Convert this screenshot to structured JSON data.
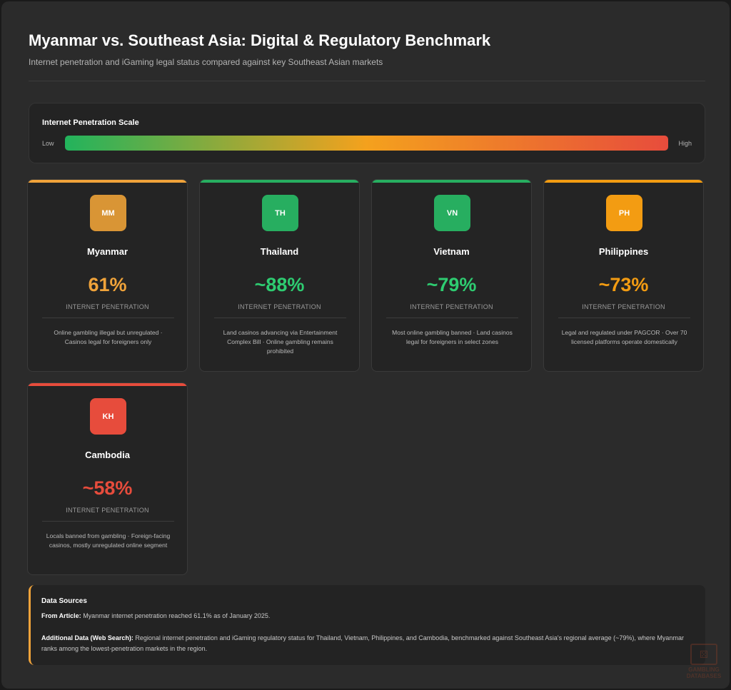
{
  "header": {
    "title": "Myanmar vs. Southeast Asia: Digital & Regulatory Benchmark",
    "subtitle": "Internet penetration and iGaming legal status compared against key Southeast Asian markets"
  },
  "scale": {
    "title": "Internet Penetration Scale",
    "low_label": "Low",
    "high_label": "High",
    "gradient_colors": [
      "#22b35c",
      "#f4a11d",
      "#e74c3c"
    ]
  },
  "cards": [
    {
      "code": "MM",
      "name": "Myanmar",
      "penetration": "61%",
      "label": "INTERNET PENETRATION",
      "description": "Online gambling illegal but unregulated · Casinos legal for foreigners only",
      "accent": "#f0a33a",
      "badge_color": "#d99535",
      "value_color": "#f0a33a"
    },
    {
      "code": "TH",
      "name": "Thailand",
      "penetration": "~88%",
      "label": "INTERNET PENETRATION",
      "description": "Land casinos advancing via Entertainment Complex Bill · Online gambling remains prohibited",
      "accent": "#27ae60",
      "badge_color": "#27ae60",
      "value_color": "#2ecc71"
    },
    {
      "code": "VN",
      "name": "Vietnam",
      "penetration": "~79%",
      "label": "INTERNET PENETRATION",
      "description": "Most online gambling banned · Land casinos legal for foreigners in select zones",
      "accent": "#27ae60",
      "badge_color": "#27ae60",
      "value_color": "#2ecc71"
    },
    {
      "code": "PH",
      "name": "Philippines",
      "penetration": "~73%",
      "label": "INTERNET PENETRATION",
      "description": "Legal and regulated under PAGCOR · Over 70 licensed platforms operate domestically",
      "accent": "#f39c12",
      "badge_color": "#f39c12",
      "value_color": "#f39c12"
    },
    {
      "code": "KH",
      "name": "Cambodia",
      "penetration": "~58%",
      "label": "INTERNET PENETRATION",
      "description": "Locals banned from gambling · Foreign-facing casinos, mostly unregulated online segment",
      "accent": "#e74c3c",
      "badge_color": "#e74c3c",
      "value_color": "#e74c3c"
    }
  ],
  "sources": {
    "title": "Data Sources",
    "article_label": "From Article:",
    "article_text": " Myanmar internet penetration reached 61.1% as of January 2025.",
    "additional_label": "Additional Data (Web Search):",
    "additional_text": " Regional internet penetration and iGaming regulatory status for Thailand, Vietnam, Philippines, and Cambodia, benchmarked against Southeast Asia's regional average (~79%), where Myanmar ranks among the lowest-penetration markets in the region."
  },
  "watermark": {
    "line1": "GAMBLING",
    "line2": "DATABASES"
  }
}
